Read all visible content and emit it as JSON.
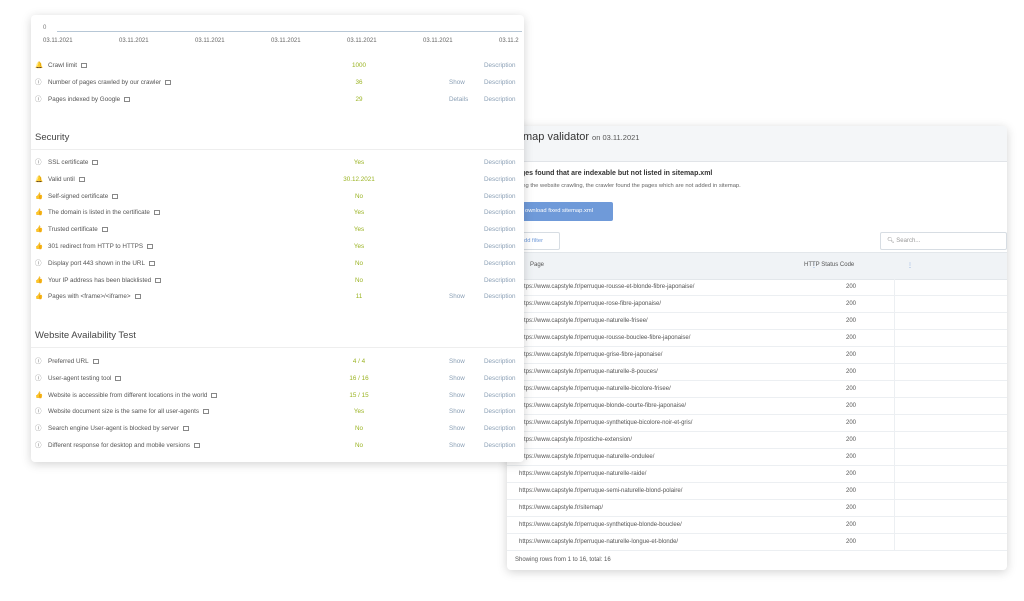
{
  "left": {
    "timeline": {
      "zero": "0",
      "dates": [
        "03.11.2021",
        "03.11.2021",
        "03.11.2021",
        "03.11.2021",
        "03.11.2021",
        "03.11.2021",
        "03.11.2"
      ]
    },
    "top_rows": [
      {
        "icon": "bell-icon",
        "glyph": "🔔",
        "label": "Crawl limit",
        "value": "1000",
        "action": "",
        "desc": "Description"
      },
      {
        "icon": "info-icon",
        "glyph": "ⓘ",
        "label": "Number of pages crawled by our crawler",
        "value": "36",
        "action": "Show",
        "desc": "Description"
      },
      {
        "icon": "info-icon",
        "glyph": "ⓘ",
        "label": "Pages indexed by Google",
        "value": "29",
        "action": "Details",
        "desc": "Description"
      }
    ],
    "security": {
      "title": "Security",
      "rows": [
        {
          "icon": "info-icon",
          "glyph": "ⓘ",
          "label": "SSL certificate",
          "value": "Yes",
          "action": "",
          "desc": "Description"
        },
        {
          "icon": "bell-icon",
          "glyph": "🔔",
          "label": "Valid until",
          "value": "30.12.2021",
          "action": "",
          "desc": "Description"
        },
        {
          "icon": "thumb-icon",
          "glyph": "👍",
          "label": "Self-signed certificate",
          "value": "No",
          "action": "",
          "desc": "Description"
        },
        {
          "icon": "thumb-icon",
          "glyph": "👍",
          "label": "The domain is listed in the certificate",
          "value": "Yes",
          "action": "",
          "desc": "Description"
        },
        {
          "icon": "thumb-icon",
          "glyph": "👍",
          "label": "Trusted certificate",
          "value": "Yes",
          "action": "",
          "desc": "Description"
        },
        {
          "icon": "thumb-icon",
          "glyph": "👍",
          "label": "301 redirect from HTTP to HTTPS",
          "value": "Yes",
          "action": "",
          "desc": "Description"
        },
        {
          "icon": "info-icon",
          "glyph": "ⓘ",
          "label": "Display port 443 shown in the URL",
          "value": "No",
          "action": "",
          "desc": "Description"
        },
        {
          "icon": "thumb-icon",
          "glyph": "👍",
          "label": "Your IP address has been blacklisted",
          "value": "No",
          "action": "",
          "desc": "Description"
        },
        {
          "icon": "thumb-icon",
          "glyph": "👍",
          "label": "Pages with <frame>/<iframe>",
          "value": "11",
          "action": "Show",
          "desc": "Description"
        }
      ]
    },
    "availability": {
      "title": "Website Availability Test",
      "rows": [
        {
          "icon": "info-icon",
          "glyph": "ⓘ",
          "label": "Preferred URL",
          "value": "4 / 4",
          "action": "Show",
          "desc": "Description"
        },
        {
          "icon": "info-icon",
          "glyph": "ⓘ",
          "label": "User-agent testing tool",
          "value": "16 / 16",
          "action": "Show",
          "desc": "Description"
        },
        {
          "icon": "thumb-icon",
          "glyph": "👍",
          "label": "Website is accessible from different locations in the world",
          "value": "15 / 15",
          "action": "Show",
          "desc": "Description"
        },
        {
          "icon": "info-icon",
          "glyph": "ⓘ",
          "label": "Website document size is the same for all user-agents",
          "value": "Yes",
          "action": "Show",
          "desc": "Description"
        },
        {
          "icon": "info-icon",
          "glyph": "ⓘ",
          "label": "Search engine User-agent is blocked by server",
          "value": "No",
          "action": "Show",
          "desc": "Description"
        },
        {
          "icon": "info-icon",
          "glyph": "ⓘ",
          "label": "Different response for desktop and mobile versions",
          "value": "No",
          "action": "Show",
          "desc": "Description"
        }
      ]
    }
  },
  "right": {
    "title": "map validator",
    "date": "on 03.11.2021",
    "subtitle": "ges found that are indexable but not listed in sitemap.xml",
    "description": "ing the website crawling, the crawler found the pages which are not added in sitemap.",
    "download_button": "ownload fixed sitemap.xml",
    "filter_button": "dd filter",
    "search_placeholder": "Search...",
    "columns": [
      "Page",
      "HTTP Status Code"
    ],
    "rows": [
      {
        "url": "https://www.capstyle.fr/perruque-rousse-et-blonde-fibre-japonaise/",
        "code": "200"
      },
      {
        "url": "https://www.capstyle.fr/perruque-rose-fibre-japonaise/",
        "code": "200"
      },
      {
        "url": "https://www.capstyle.fr/perruque-naturelle-frisee/",
        "code": "200"
      },
      {
        "url": "https://www.capstyle.fr/perruque-rousse-bouclee-fibre-japonaise/",
        "code": "200"
      },
      {
        "url": "https://www.capstyle.fr/perruque-grise-fibre-japonaise/",
        "code": "200"
      },
      {
        "url": "https://www.capstyle.fr/perruque-naturelle-8-pouces/",
        "code": "200"
      },
      {
        "url": "https://www.capstyle.fr/perruque-naturelle-bicolore-frisee/",
        "code": "200"
      },
      {
        "url": "https://www.capstyle.fr/perruque-blonde-courte-fibre-japonaise/",
        "code": "200"
      },
      {
        "url": "https://www.capstyle.fr/perruque-synthetique-bicolore-noir-et-gris/",
        "code": "200"
      },
      {
        "url": "https://www.capstyle.fr/postiche-extension/",
        "code": "200"
      },
      {
        "url": "https://www.capstyle.fr/perruque-naturelle-ondulee/",
        "code": "200"
      },
      {
        "url": "https://www.capstyle.fr/perruque-naturelle-raide/",
        "code": "200"
      },
      {
        "url": "https://www.capstyle.fr/perruque-semi-naturelle-blond-polaire/",
        "code": "200"
      },
      {
        "url": "https://www.capstyle.fr/sitemap/",
        "code": "200"
      },
      {
        "url": "https://www.capstyle.fr/perruque-synthetique-blonde-bouclee/",
        "code": "200"
      },
      {
        "url": "https://www.capstyle.fr/perruque-naturelle-longue-et-blonde/",
        "code": "200"
      }
    ],
    "footer": "Showing rows from 1 to 16, total: 16"
  }
}
